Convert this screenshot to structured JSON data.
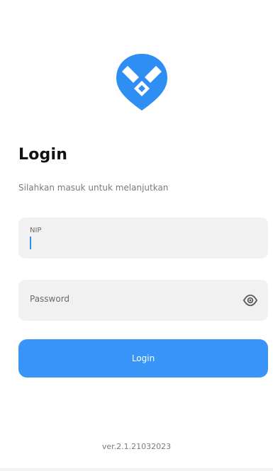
{
  "login": {
    "title": "Login",
    "subtitle": "Silahkan masuk untuk melanjutkan",
    "nip_label": "NIP",
    "password_placeholder": "Password",
    "button_label": "Login"
  },
  "footer": {
    "version": "ver.2.1.21032023"
  },
  "icons": {
    "logo": "map-pin-x-logo",
    "toggle_password": "eye-icon"
  },
  "colors": {
    "brand": "#2F8EF4",
    "button": "#3895F7",
    "field_bg": "#F1F1F1",
    "title": "#111111",
    "muted_text": "#7A7A7A"
  }
}
